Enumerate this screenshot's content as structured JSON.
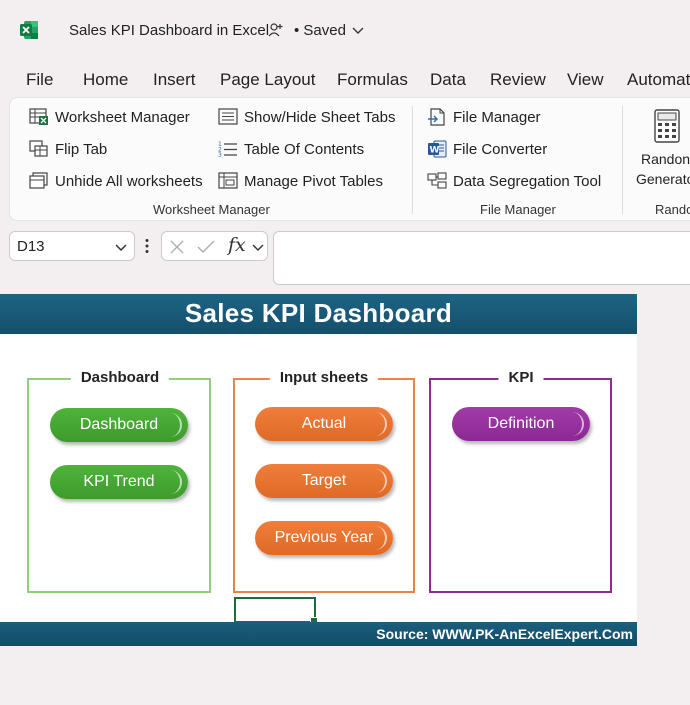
{
  "titlebar": {
    "title": "Sales KPI Dashboard in Excel",
    "status": "• Saved"
  },
  "menu": [
    "File",
    "Home",
    "Insert",
    "Page Layout",
    "Formulas",
    "Data",
    "Review",
    "View",
    "Automat"
  ],
  "ribbon": {
    "worksheet_manager_group": {
      "label": "Worksheet Manager",
      "items": [
        {
          "label": "Worksheet Manager",
          "icon": "worksheet-manager-icon"
        },
        {
          "label": "Flip Tab",
          "icon": "flip-tab-icon"
        },
        {
          "label": "Unhide All worksheets",
          "icon": "unhide-worksheets-icon"
        },
        {
          "label": "Show/Hide Sheet Tabs",
          "icon": "sheet-tabs-icon"
        },
        {
          "label": "Table Of Contents",
          "icon": "table-of-contents-icon"
        },
        {
          "label": "Manage Pivot Tables",
          "icon": "pivot-tables-icon"
        }
      ]
    },
    "file_manager_group": {
      "label": "File Manager",
      "items": [
        {
          "label": "File Manager",
          "icon": "file-manager-icon"
        },
        {
          "label": "File Converter",
          "icon": "word-file-icon"
        },
        {
          "label": "Data Segregation Tool",
          "icon": "data-segregation-icon"
        }
      ]
    },
    "random_group": {
      "line1": "Randon",
      "line2": "Generato",
      "label": "Rando"
    }
  },
  "formula_bar": {
    "cell_ref": "D13",
    "fx": "fx",
    "formula": ""
  },
  "dashboard": {
    "title": "Sales KPI Dashboard",
    "footer": "Source: WWW.PK-AnExcelExpert.Com",
    "panels": [
      {
        "title": "Dashboard",
        "buttons": [
          "Dashboard",
          "KPI Trend"
        ]
      },
      {
        "title": "Input sheets",
        "buttons": [
          "Actual",
          "Target",
          "Previous Year"
        ]
      },
      {
        "title": "KPI",
        "buttons": [
          "Definition"
        ]
      }
    ]
  },
  "colors": {
    "excel_green": "#1e7145",
    "header_blue": "#1a5c7c",
    "panel_green": "#8fcf7a",
    "panel_orange": "#e8834a",
    "panel_purple": "#8e2c92",
    "pill_green": "#45a933",
    "pill_orange": "#e87230",
    "pill_purple": "#982f9e"
  }
}
